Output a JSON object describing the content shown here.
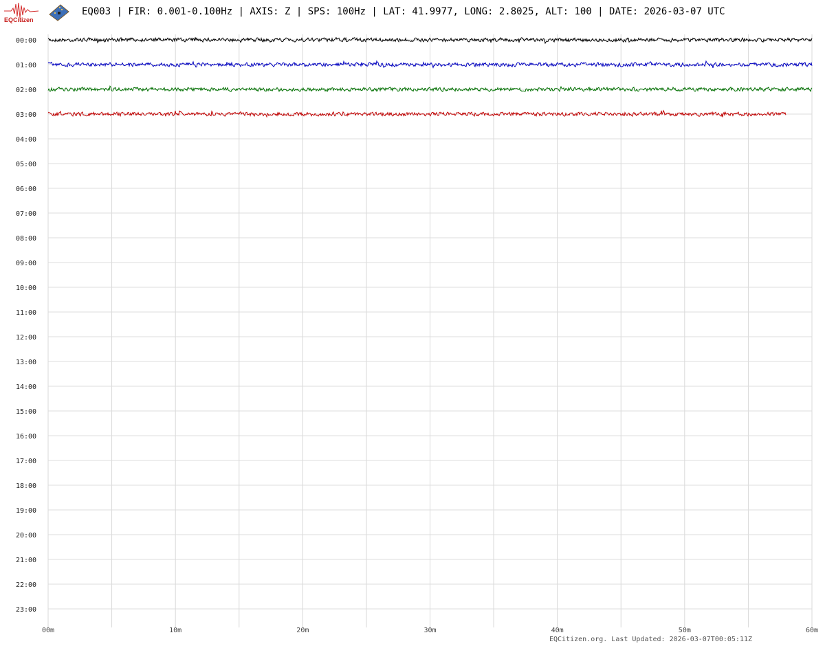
{
  "header": {
    "logo_text": "EQCitizen",
    "title": "EQ003 | FIR: 0.001-0.100Hz | AXIS: Z | SPS: 100Hz | LAT: 41.9977, LONG: 2.8025, ALT: 100 | DATE: 2026-03-07 UTC"
  },
  "hours": [
    "00:00",
    "01:00",
    "02:00",
    "03:00",
    "04:00",
    "05:00",
    "06:00",
    "07:00",
    "08:00",
    "09:00",
    "10:00",
    "11:00",
    "12:00",
    "13:00",
    "14:00",
    "15:00",
    "16:00",
    "17:00",
    "18:00",
    "19:00",
    "20:00",
    "21:00",
    "22:00",
    "23:00"
  ],
  "x_ticks": [
    "00m",
    "10m",
    "20m",
    "30m",
    "40m",
    "50m",
    "60m"
  ],
  "traces": [
    {
      "hour": "00:00",
      "color": "#000000",
      "minutes": 60
    },
    {
      "hour": "01:00",
      "color": "#0000c0",
      "minutes": 60
    },
    {
      "hour": "02:00",
      "color": "#007000",
      "minutes": 60
    },
    {
      "hour": "03:00",
      "color": "#c00000",
      "minutes": 58
    }
  ],
  "footer": "EQCitizen.org. Last Updated: 2026-03-07T00:05:11Z"
}
